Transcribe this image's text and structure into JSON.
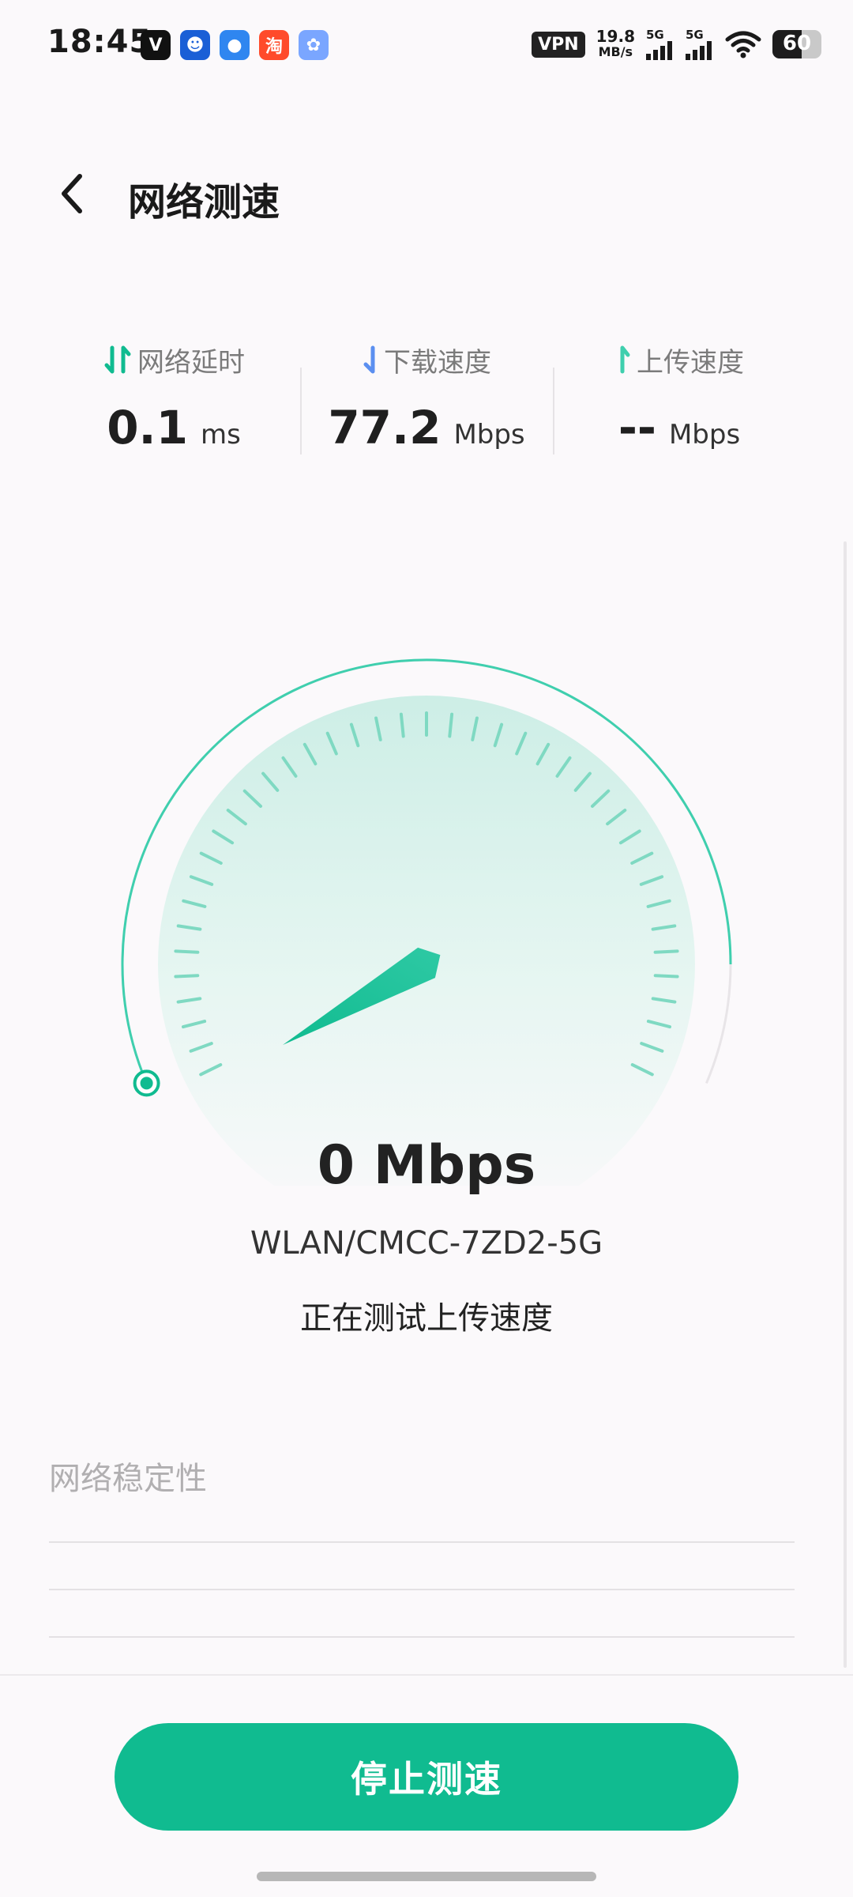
{
  "status_bar": {
    "time": "18:45",
    "vpn": "VPN",
    "net_speed_value": "19.8",
    "net_speed_unit": "MB/s",
    "sim1_label": "5G",
    "sim2_label": "5G",
    "battery": "60",
    "battery_level": 0.6,
    "notification_icons": [
      {
        "name": "v-app-icon",
        "glyph": "V",
        "color": "#111111"
      },
      {
        "name": "robot-app-icon",
        "glyph": "☻",
        "color": "#1a5fd6"
      },
      {
        "name": "blue-app-icon",
        "glyph": "●",
        "color": "#2f86f0"
      },
      {
        "name": "taobao-app-icon",
        "glyph": "淘",
        "color": "#ff4b2b"
      },
      {
        "name": "cluster-app-icon",
        "glyph": "✿",
        "color": "#7aa6ff"
      }
    ]
  },
  "header": {
    "title": "网络测速"
  },
  "metrics": {
    "latency": {
      "label": "网络延时",
      "value": "0.1",
      "unit": "ms"
    },
    "download": {
      "label": "下载速度",
      "value": "77.2",
      "unit": "Mbps"
    },
    "upload": {
      "label": "上传速度",
      "value": "--",
      "unit": "Mbps"
    }
  },
  "gauge": {
    "current_speed": 0,
    "speed_text": "0 Mbps",
    "network_name": "WLAN/CMCC-7ZD2-5G",
    "status": "正在测试上传速度"
  },
  "stability": {
    "label": "网络稳定性"
  },
  "actions": {
    "stop_label": "停止测速"
  },
  "colors": {
    "accent": "#10bb90",
    "accent_light": "#3fcfae",
    "download_blue": "#5b8ff0"
  }
}
